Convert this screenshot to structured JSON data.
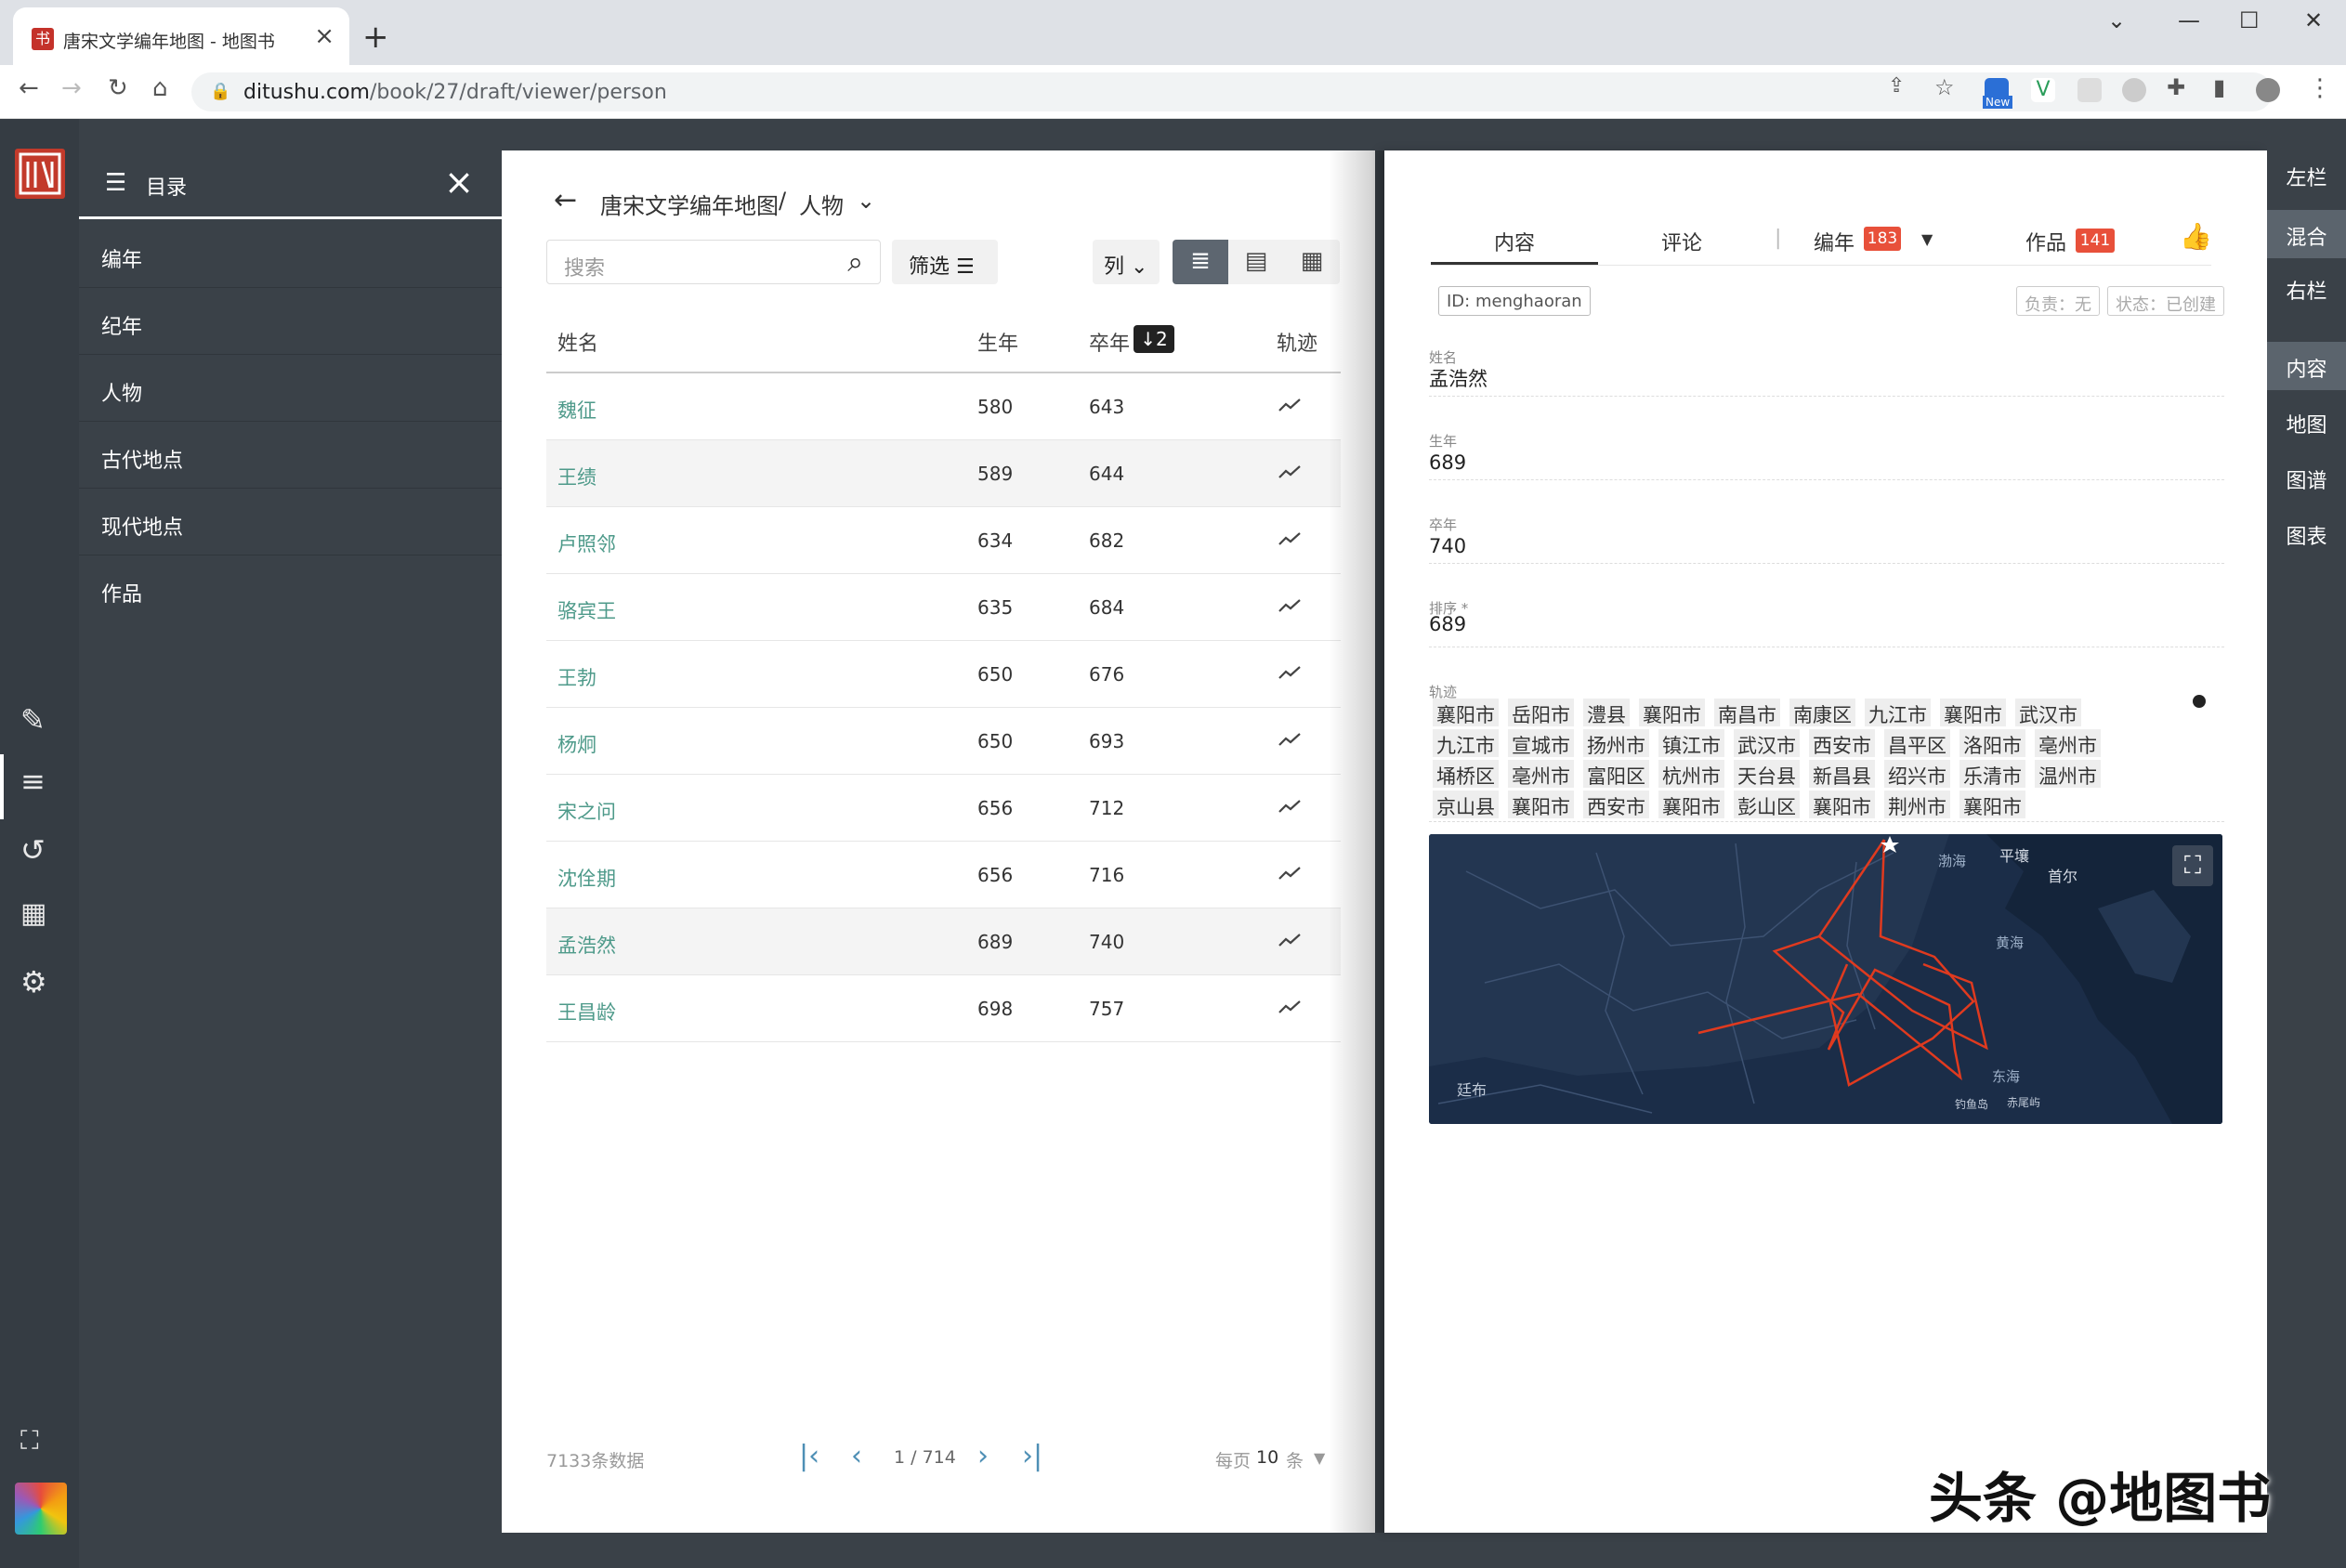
{
  "browser": {
    "tab_title": "唐宋文学编年地图 - 地图书",
    "tab_favicon_char": "书",
    "url_host": "ditushu.com",
    "url_path": "/book/27/draft/viewer/person",
    "ext_new_badge": "New"
  },
  "toc": {
    "title": "目录",
    "items": [
      "编年",
      "纪年",
      "人物",
      "古代地点",
      "现代地点",
      "作品"
    ]
  },
  "left_page": {
    "breadcrumb": {
      "book": "唐宋文学编年地图",
      "sep": "/",
      "section": "人物"
    },
    "search_placeholder": "搜索",
    "filter_label": "筛选",
    "columns_label": "列",
    "table": {
      "headers": {
        "name": "姓名",
        "born": "生年",
        "died": "卒年",
        "track": "轨迹"
      },
      "sort_badge": "↓2",
      "rows": [
        {
          "name": "魏征",
          "born": "580",
          "died": "643"
        },
        {
          "name": "王绩",
          "born": "589",
          "died": "644"
        },
        {
          "name": "卢照邻",
          "born": "634",
          "died": "682"
        },
        {
          "name": "骆宾王",
          "born": "635",
          "died": "684"
        },
        {
          "name": "王勃",
          "born": "650",
          "died": "676"
        },
        {
          "name": "杨炯",
          "born": "650",
          "died": "693"
        },
        {
          "name": "宋之问",
          "born": "656",
          "died": "712"
        },
        {
          "name": "沈佺期",
          "born": "656",
          "died": "716"
        },
        {
          "name": "孟浩然",
          "born": "689",
          "died": "740"
        },
        {
          "name": "王昌龄",
          "born": "698",
          "died": "757"
        }
      ]
    },
    "pager": {
      "total": "7133条数据",
      "page": "1 / 714",
      "per_page_prefix": "每页",
      "per_page": "10",
      "per_page_suffix": "条"
    }
  },
  "right_page": {
    "tabs": {
      "content": "内容",
      "comments": "评论",
      "chronicle": "编年",
      "chronicle_count": "183",
      "works": "作品",
      "works_count": "141"
    },
    "id_tag": "ID: menghaoran",
    "owner_tag": "负责：无",
    "status_tag": "状态：已创建",
    "fields": {
      "name_label": "姓名",
      "name": "孟浩然",
      "born_label": "生年",
      "born": "689",
      "died_label": "卒年",
      "died": "740",
      "order_label": "排序 *",
      "order": "689",
      "track_label": "轨迹"
    },
    "track_lines": [
      [
        "襄阳市",
        "岳阳市",
        "澧县",
        "襄阳市",
        "南昌市",
        "南康区",
        "九江市",
        "襄阳市",
        "武汉市"
      ],
      [
        "九江市",
        "宣城市",
        "扬州市",
        "镇江市",
        "武汉市",
        "西安市",
        "昌平区",
        "洛阳市",
        "亳州市"
      ],
      [
        "埇桥区",
        "亳州市",
        "富阳区",
        "杭州市",
        "天台县",
        "新昌县",
        "绍兴市",
        "乐清市",
        "温州市"
      ],
      [
        "京山县",
        "襄阳市",
        "西安市",
        "襄阳市",
        "彭山区",
        "襄阳市",
        "荆州市",
        "襄阳市"
      ]
    ],
    "map_labels": [
      "渤海",
      "平壤",
      "首尔",
      "黄海",
      "东海",
      "钓鱼岛",
      "赤尾屿",
      "廷布"
    ]
  },
  "right_rail": {
    "items": [
      "左栏",
      "混合",
      "右栏",
      "内容",
      "地图",
      "图谱",
      "图表"
    ]
  },
  "watermark": "头条 @地图书"
}
